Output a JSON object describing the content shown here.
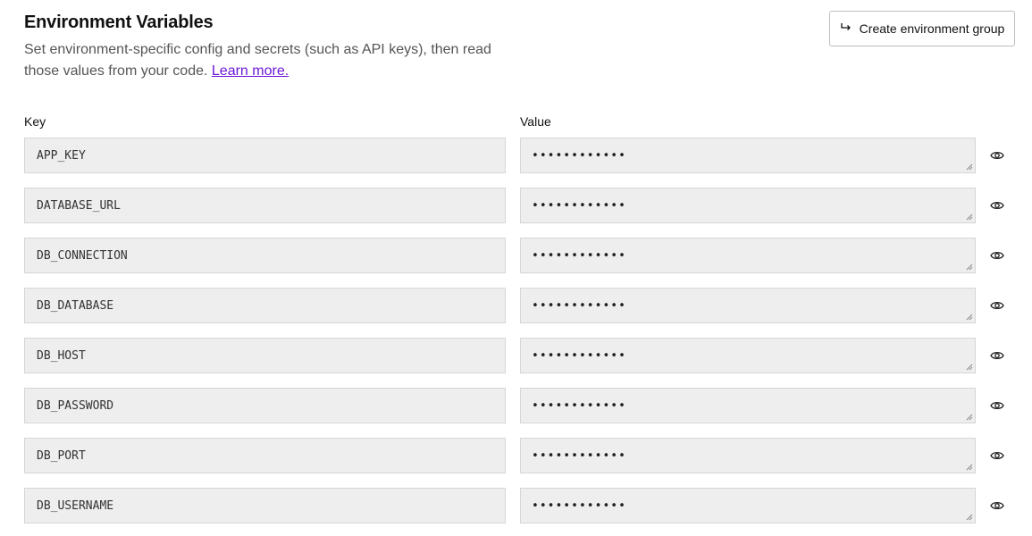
{
  "header": {
    "title": "Environment Variables",
    "description": "Set environment-specific config and secrets (such as API keys), then read those values from your code.",
    "learn_more": "Learn more.",
    "create_group_label": "Create environment group",
    "create_group_icon": "return-arrow-icon"
  },
  "columns": {
    "key": "Key",
    "value": "Value"
  },
  "variables": [
    {
      "key": "APP_KEY",
      "value": "••••••••••••"
    },
    {
      "key": "DATABASE_URL",
      "value": "••••••••••••"
    },
    {
      "key": "DB_CONNECTION",
      "value": "••••••••••••"
    },
    {
      "key": "DB_DATABASE",
      "value": "••••••••••••"
    },
    {
      "key": "DB_HOST",
      "value": "••••••••••••"
    },
    {
      "key": "DB_PASSWORD",
      "value": "••••••••••••"
    },
    {
      "key": "DB_PORT",
      "value": "••••••••••••"
    },
    {
      "key": "DB_USERNAME",
      "value": "••••••••••••"
    }
  ],
  "reveal_icon": "eye-icon",
  "colors": {
    "link": "#6b16d9",
    "field_bg": "#eeeeee",
    "field_border": "#d6d6d6"
  }
}
